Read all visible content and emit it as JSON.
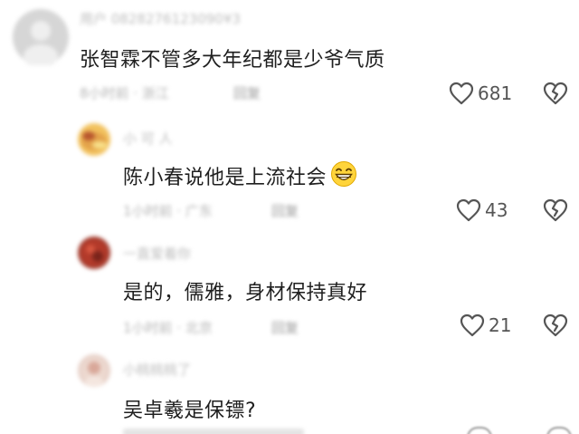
{
  "comments": [
    {
      "username": "用户 0828276123090¥3",
      "text": "张智霖不管多大年纪都是少爷气质",
      "meta": "8小时前 · 浙江",
      "reply": "回复",
      "likes": "681",
      "avatar_color": "#cfcfcf"
    },
    {
      "username": "小 可 人",
      "text": "陈小春说他是上流社会",
      "emoji": "grinning-face-emoji",
      "meta": "1小时前 · 广东",
      "reply": "回复",
      "likes": "43",
      "avatar_color": "#e3a24a"
    },
    {
      "username": "一直爱着你",
      "text": "是的，儒雅，身材保持真好",
      "meta": "1小时前 · 北京",
      "reply": "回复",
      "likes": "21",
      "avatar_color": "#a03a2c"
    },
    {
      "username": "小桃桃桃了",
      "text": "吴卓羲是保镖?",
      "avatar_color": "#e6cfc6"
    }
  ],
  "icons": {
    "like": "heart-outline-icon",
    "dislike": "broken-heart-icon"
  }
}
